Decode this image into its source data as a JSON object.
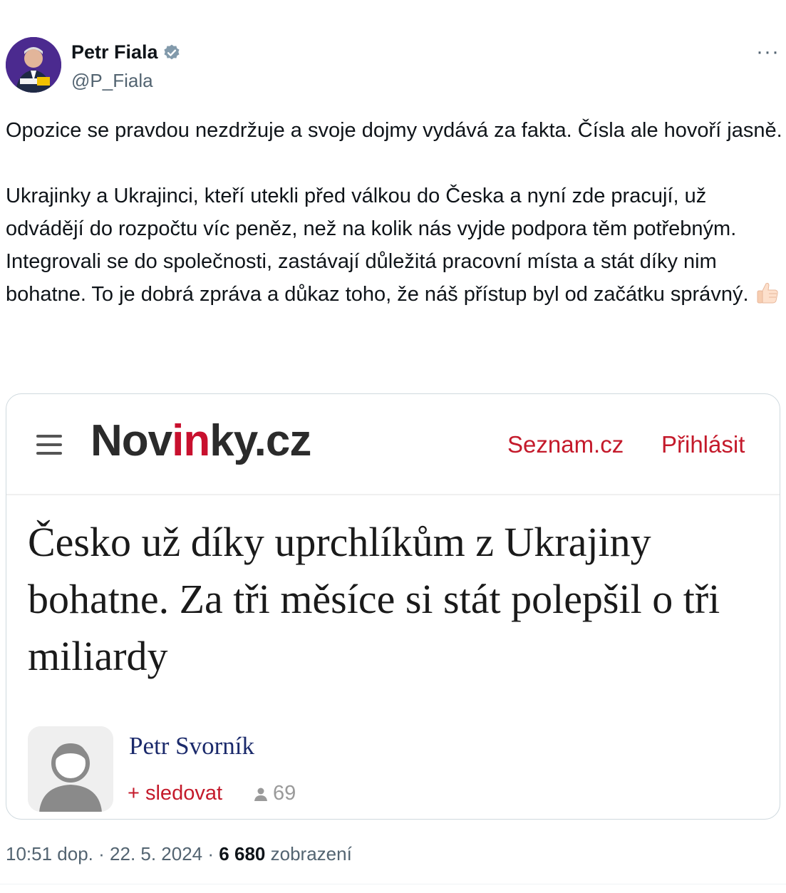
{
  "author": {
    "name": "Petr Fiala",
    "handle": "@P_Fiala"
  },
  "more_menu_label": "···",
  "tweet": {
    "paragraphs": [
      "Opozice se pravdou nezdržuje a svoje dojmy vydává za fakta. Čísla ale hovoří jasně.",
      "Ukrajinky a Ukrajinci, kteří utekli před válkou do Česka a nyní zde pracují, už odvádějí do rozpočtu víc peněz, než na kolik nás vyjde podpora těm potřebným. Integrovali se do společnosti, zastávají důležitá pracovní místa a stát díky nim bohatne. To je dobrá zpráva a důkaz toho, že náš přístup byl od začátku správný."
    ],
    "emoji": "thumbs-up-icon"
  },
  "card": {
    "logo_prefix": "Nov",
    "logo_accent": "in",
    "logo_suffix": "ky.cz",
    "nav_links": [
      "Seznam.cz",
      "Přihlásit"
    ],
    "headline": "Česko už díky uprchlíkům z Ukrajiny bohatne. Za tři měsíce si stát polepšil o tři miliardy",
    "article_author": "Petr Svorník",
    "follow_label": "+ sledovat",
    "followers_count": "69"
  },
  "meta": {
    "time": "10:51 dop.",
    "separator": "·",
    "date": "22. 5. 2024",
    "views_count": "6 680",
    "views_label": "zobrazení"
  },
  "colors": {
    "accent_red": "#c41a2b",
    "verified_blue": "#829aab",
    "author_link": "#1b2a6b"
  }
}
